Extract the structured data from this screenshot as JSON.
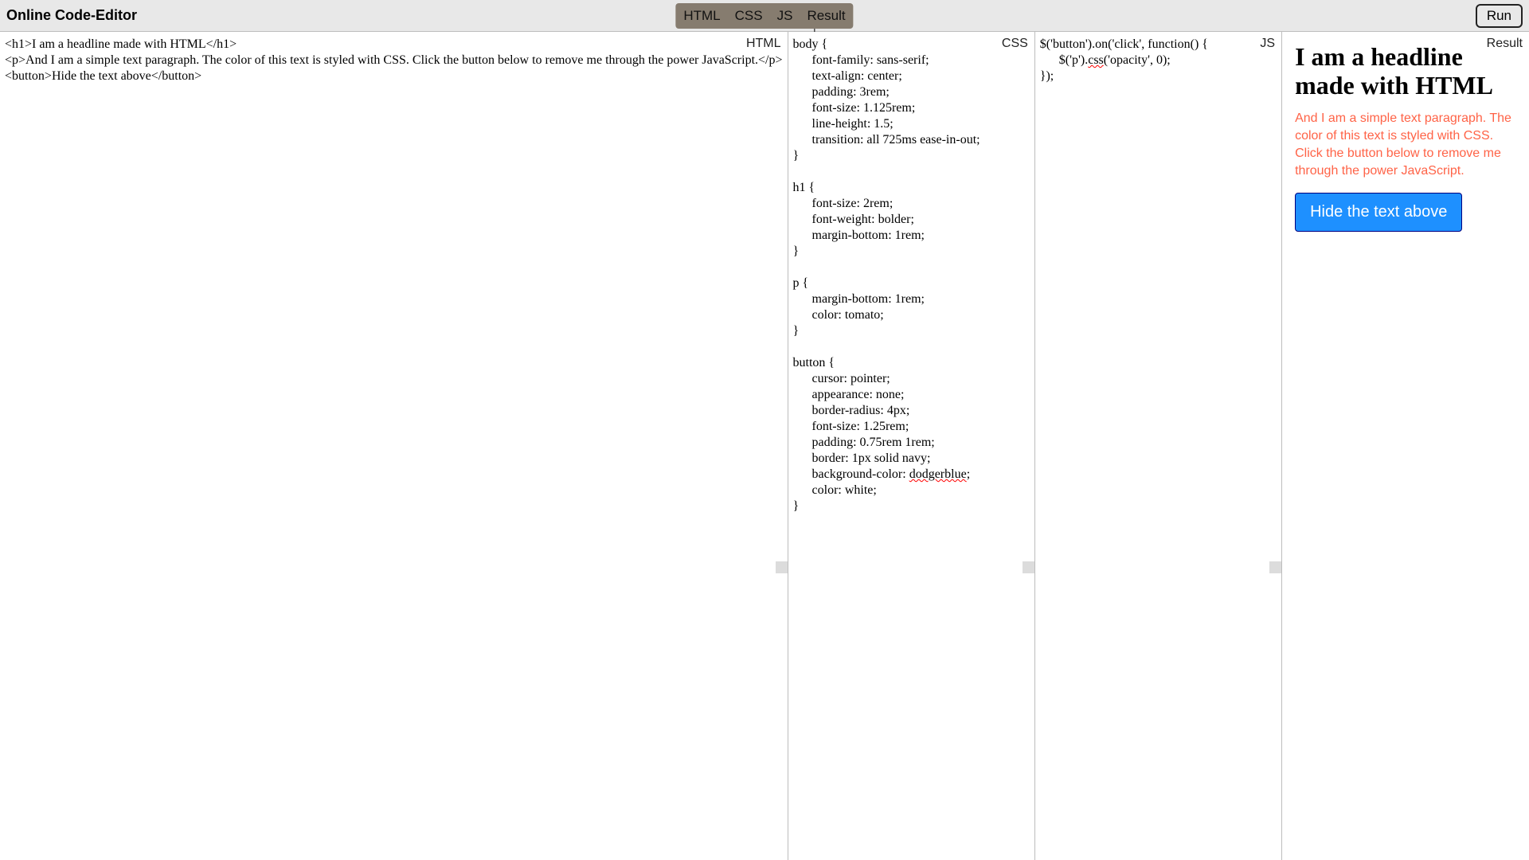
{
  "app_title": "Online Code-Editor",
  "toggles": {
    "html": "HTML",
    "css": "CSS",
    "js": "JS",
    "result": "Result"
  },
  "run_label": "Run",
  "panes": {
    "html": {
      "label": "HTML"
    },
    "css": {
      "label": "CSS"
    },
    "js": {
      "label": "JS"
    },
    "result": {
      "label": "Result"
    }
  },
  "code": {
    "html": "<h1>I am a headline made with HTML</h1>\n<p>And I am a simple text paragraph. The color of this text is styled with CSS. Click the button below to remove me through the power JavaScript.</p>\n<button>Hide the text above</button>",
    "css_pre": "body {\n      font-family: sans-serif;\n      text-align: center;\n      padding: 3rem;\n      font-size: 1.125rem;\n      line-height: 1.5;\n      transition: all 725ms ease-in-out;\n}\n\nh1 {\n      font-size: 2rem;\n      font-weight: bolder;\n      margin-bottom: 1rem;\n}\n\np {\n      margin-bottom: 1rem;\n      color: tomato;\n}\n\nbutton {\n      cursor: pointer;\n      appearance: none;\n      border-radius: 4px;\n      font-size: 1.25rem;\n      padding: 0.75rem 1rem;\n      border: 1px solid navy;\n      background-color: ",
    "css_err": "dodgerblue",
    "css_post": ";\n      color: white;\n}",
    "js_pre": "$('button').on('click', function() {\n      $('p').",
    "js_err": "css",
    "js_post": "('opacity', 0);\n});"
  },
  "result": {
    "headline": "I am a headline made with HTML",
    "paragraph": "And I am a simple text paragraph. The color of this text is styled with CSS. Click the button below to remove me through the power JavaScript.",
    "button": "Hide the text above"
  }
}
